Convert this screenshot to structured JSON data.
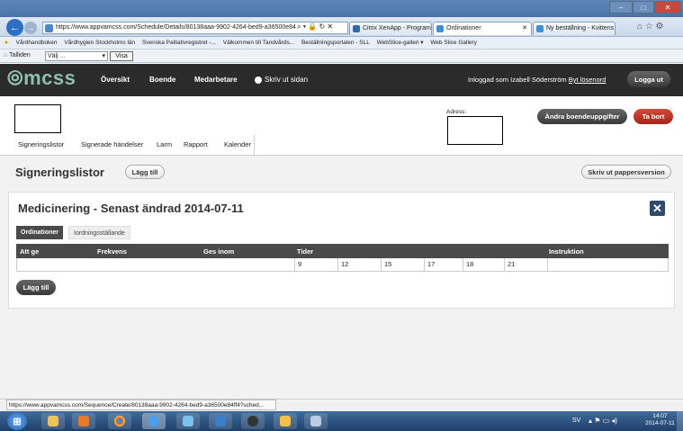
{
  "browser": {
    "address": "https://www.appvamcss.com/Schedule/Details/80138aaa-9902-4264-bed9-a36500e84",
    "tabs": [
      {
        "label": "Citrix XenApp - Program"
      },
      {
        "label": "Ordinationer"
      },
      {
        "label": "Ny beställning - Kvittens"
      }
    ],
    "favorites": [
      "Vårdhandboken",
      "Vårdhygien Stockholms län",
      "Svenska Palliativregistret -...",
      "Välkommen till Tandvårds...",
      "Beställningsportalen - SLL",
      "WebSlice-galleri ▾",
      "Web Slice Gallery"
    ],
    "command_bar": {
      "site": "Talliden",
      "select_value": "Välj ...",
      "visa_label": "Visa"
    }
  },
  "header": {
    "logo": "mcss",
    "nav": [
      "Översikt",
      "Boende",
      "Medarbetare"
    ],
    "print_label": "Skriv ut sidan",
    "logged_in_text": "Inloggad som Izabell Söderström",
    "change_password": "Byt lösenord",
    "logout": "Logga ut"
  },
  "resident": {
    "address_label": "Adress:",
    "change_fees_label": "Ändra boendeuppgifter",
    "delete_label": "Ta bort"
  },
  "subnav": [
    "Signeringslistor",
    "Signerade händelser",
    "Larm",
    "Rapport",
    "Kalender"
  ],
  "section": {
    "title": "Signeringslistor",
    "add_label": "Lägg till",
    "print_paper_label": "Skriv ut pappersversion"
  },
  "panel": {
    "title": "Medicinering - Senast ändrad 2014-07-11",
    "tabs": [
      "Ordinationer",
      "Iordningsställande"
    ],
    "columns": [
      "Att ge",
      "Frekvens",
      "Ges inom",
      "Tider",
      "Instruktion"
    ],
    "times": [
      "9",
      "12",
      "15",
      "17",
      "18",
      "21"
    ],
    "add_label": "Lägg till"
  },
  "status_url": "https://www.appvamcss.com/Sequence/Create/80138aaa-9902-4264-bed9-a36500e84ff4?sched...",
  "tray": {
    "lang": "SV",
    "time": "14:07",
    "date": "2014-07-11"
  }
}
